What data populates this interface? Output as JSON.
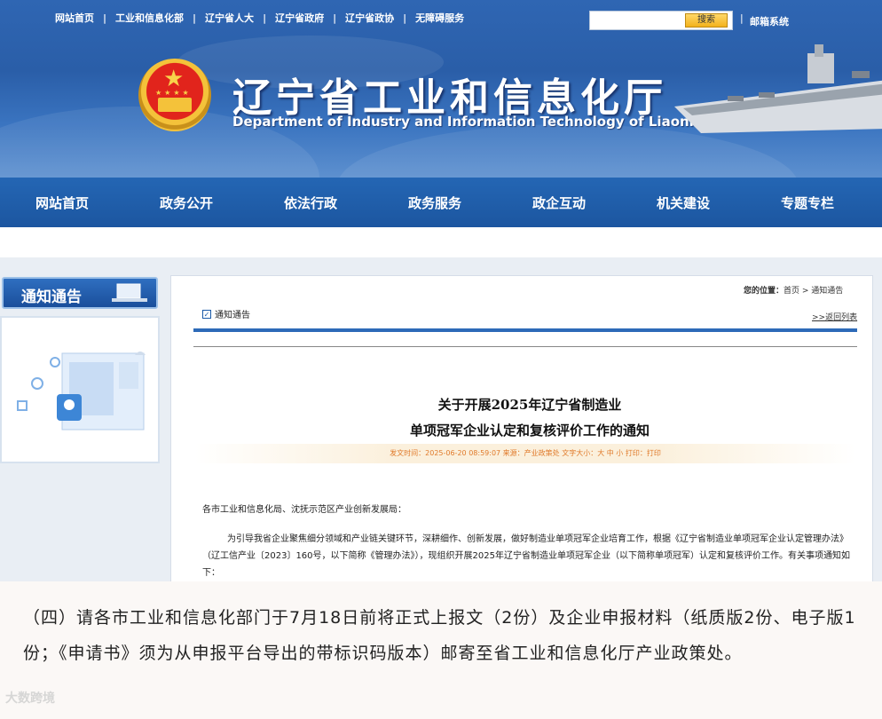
{
  "header": {
    "top_links": [
      "网站首页",
      "工业和信息化部",
      "辽宁省人大",
      "辽宁省政府",
      "辽宁省政协",
      "无障碍服务"
    ],
    "search_button": "搜索",
    "search_placeholder": "",
    "mail_link": "邮箱系统",
    "title_cn": "辽宁省工业和信息化厅",
    "title_en": "Department of Industry and Information Technology of Liaoning Province"
  },
  "nav": [
    "网站首页",
    "政务公开",
    "依法行政",
    "政务服务",
    "政企互动",
    "机关建设",
    "专题专栏"
  ],
  "sidebar": {
    "title": "通知通告"
  },
  "main": {
    "location_label": "您的位置：",
    "location_path": "首页 > 通知通告",
    "section_tag": "通知通告",
    "back_link": ">>返回列表",
    "article_title_line1": "关于开展2025年辽宁省制造业",
    "article_title_line2": "单项冠军企业认定和复核评价工作的通知",
    "meta": "发文时间：2025-06-20 08:59:07  来源：产业政策处  文字大小：大 中 小     打印：打印",
    "salutation": "各市工业和信息化局、沈抚示范区产业创新发展局：",
    "paragraph": "为引导我省企业聚焦细分领域和产业链关键环节，深耕细作、创新发展，做好制造业单项冠军企业培育工作，根据《辽宁省制造业单项冠军企业认定管理办法》（辽工信产业〔2023〕160号，以下简称《管理办法》），现组织开展2025年辽宁省制造业单项冠军企业（以下简称单项冠军）认定和复核评价工作。有关事项通知如下："
  },
  "zoomed_excerpt": "（四）请各市工业和信息化部门于7月18日前将正式上报文（2份）及企业申报材料（纸质版2份、电子版1份；《申请书》须为从申报平台导出的带标识码版本）邮寄至省工业和信息化厅产业政策处。",
  "watermark": "大数跨境",
  "colors": {
    "nav_bg": "#1c56a0",
    "banner": "#2a5ea8",
    "meta_text": "#e07a2a"
  }
}
